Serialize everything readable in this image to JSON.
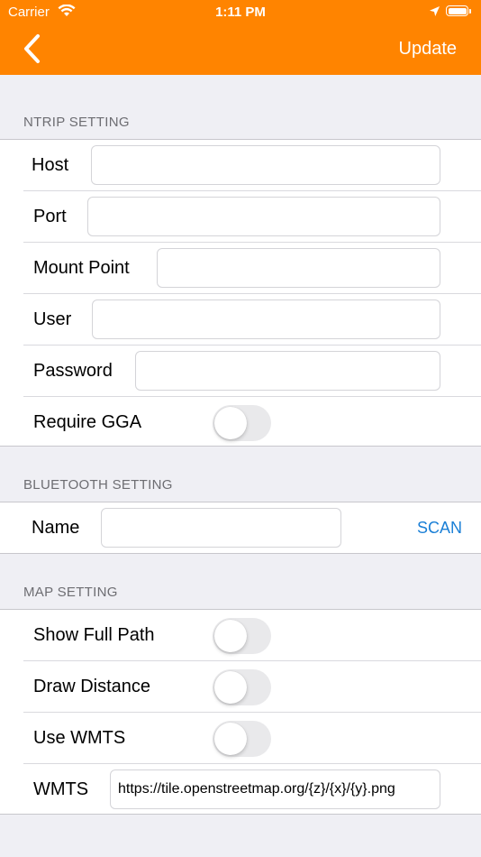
{
  "status_bar": {
    "carrier": "Carrier",
    "time": "1:11 PM"
  },
  "nav": {
    "update_label": "Update"
  },
  "colors": {
    "accent": "#ff8400",
    "link": "#1a7fd6",
    "toggle_off": "#e9e9eb"
  },
  "ntrip": {
    "header": "NTRIP SETTING",
    "host": {
      "label": "Host",
      "value": ""
    },
    "port": {
      "label": "Port",
      "value": ""
    },
    "mount_point": {
      "label": "Mount Point",
      "value": ""
    },
    "user": {
      "label": "User",
      "value": ""
    },
    "password": {
      "label": "Password",
      "value": ""
    },
    "require_gga": {
      "label": "Require GGA",
      "on": false
    }
  },
  "bluetooth": {
    "header": "BLUETOOTH SETTING",
    "name": {
      "label": "Name",
      "value": ""
    },
    "scan_label": "SCAN"
  },
  "map": {
    "header": "MAP SETTING",
    "show_full_path": {
      "label": "Show Full Path",
      "on": false
    },
    "draw_distance": {
      "label": "Draw Distance",
      "on": false
    },
    "use_wmts": {
      "label": "Use WMTS",
      "on": false
    },
    "wmts": {
      "label": "WMTS",
      "value": "https://tile.openstreetmap.org/{z}/{x}/{y}.png"
    }
  }
}
